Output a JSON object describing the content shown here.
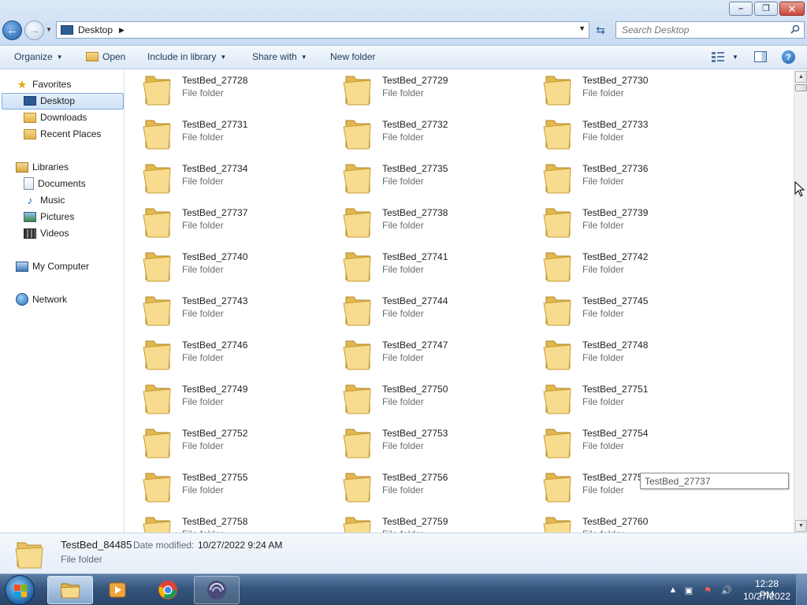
{
  "window": {
    "minimize_glyph": "–",
    "maximize_glyph": "❐",
    "close_glyph": "✕"
  },
  "address": {
    "location": "Desktop",
    "separator": "▶",
    "dropdown": "▼"
  },
  "search": {
    "placeholder": "Search Desktop"
  },
  "toolbar": {
    "organize": "Organize",
    "open": "Open",
    "include_in_library": "Include in library",
    "share_with": "Share with",
    "new_folder": "New folder",
    "caret": "▼"
  },
  "nav": {
    "favorites": "Favorites",
    "desktop": "Desktop",
    "downloads": "Downloads",
    "recent_places": "Recent Places",
    "libraries": "Libraries",
    "documents": "Documents",
    "music": "Music",
    "pictures": "Pictures",
    "videos": "Videos",
    "my_computer": "My Computer",
    "network": "Network"
  },
  "folder_type": "File folder",
  "folders": [
    "TestBed_27728",
    "TestBed_27729",
    "TestBed_27730",
    "TestBed_27731",
    "TestBed_27732",
    "TestBed_27733",
    "TestBed_27734",
    "TestBed_27735",
    "TestBed_27736",
    "TestBed_27737",
    "TestBed_27738",
    "TestBed_27739",
    "TestBed_27740",
    "TestBed_27741",
    "TestBed_27742",
    "TestBed_27743",
    "TestBed_27744",
    "TestBed_27745",
    "TestBed_27746",
    "TestBed_27747",
    "TestBed_27748",
    "TestBed_27749",
    "TestBed_27750",
    "TestBed_27751",
    "TestBed_27752",
    "TestBed_27753",
    "TestBed_27754",
    "TestBed_27755",
    "TestBed_27756",
    "TestBed_27757",
    "TestBed_27758",
    "TestBed_27759",
    "TestBed_27760"
  ],
  "tooltip": {
    "text": "TestBed_27737"
  },
  "details": {
    "name": "TestBed_84485",
    "modified_label": "Date modified:",
    "modified_value": "10/27/2022 9:24 AM",
    "type": "File folder"
  },
  "taskbar": {
    "time": "12:28 PM",
    "date": "10/27/2022"
  },
  "colors": {
    "folder_light": "#f7dc8f",
    "folder_dark": "#dcae45",
    "selection": "#cfe2f8",
    "taskbar": "#35557d"
  }
}
